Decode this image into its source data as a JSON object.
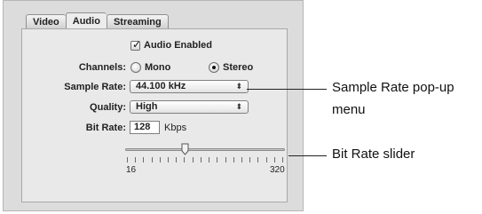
{
  "tabs": [
    {
      "label": "Video",
      "active": false
    },
    {
      "label": "Audio",
      "active": true
    },
    {
      "label": "Streaming",
      "active": false
    }
  ],
  "audio_enabled": {
    "label": "Audio Enabled",
    "checked": true
  },
  "channels": {
    "label": "Channels:",
    "options": [
      "Mono",
      "Stereo"
    ],
    "selected": "Stereo"
  },
  "sample_rate": {
    "label": "Sample Rate:",
    "value": "44.100 kHz"
  },
  "quality": {
    "label": "Quality:",
    "value": "High"
  },
  "bit_rate": {
    "label": "Bit Rate:",
    "value": "128",
    "unit": "Kbps",
    "slider_min": "16",
    "slider_max": "320",
    "slider_value": 128
  },
  "callouts": {
    "sample_rate_line1": "Sample Rate pop-up",
    "sample_rate_line2": "menu",
    "bit_rate": "Bit Rate slider"
  },
  "colors": {
    "panel": "#dcdcdc",
    "inner": "#e9e9e9"
  }
}
